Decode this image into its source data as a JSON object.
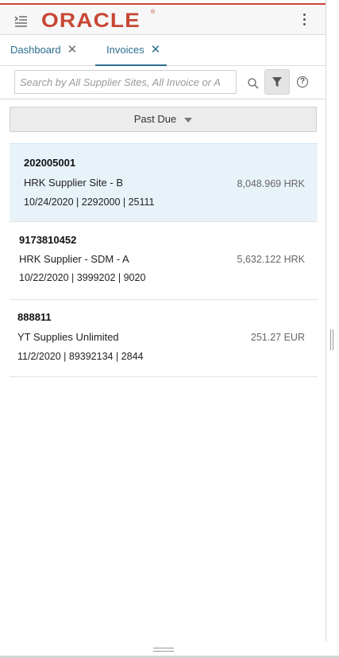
{
  "header": {
    "logo": "ORACLE",
    "logo_mark": "®",
    "menu_icon": "menu-collapse-icon",
    "more_icon": "kebab-menu-icon"
  },
  "tabs": [
    {
      "label": "Dashboard",
      "close": "✕",
      "active": false
    },
    {
      "label": "Invoices",
      "close": "✕",
      "active": true
    }
  ],
  "search": {
    "placeholder": "Search by All Supplier Sites, All Invoice or A",
    "value": "",
    "search_icon": "search-icon",
    "filter_icon": "filter-icon",
    "help_icon": "?"
  },
  "filter_select": {
    "selected": "Past Due"
  },
  "invoices": [
    {
      "number": "202005001",
      "supplier": "HRK Supplier Site - B",
      "details": "10/24/2020 | 2292000 | 25111",
      "amount": "8,048.969 HRK",
      "selected": true
    },
    {
      "number": "9173810452",
      "supplier": "HRK Supplier - SDM - A",
      "details": "10/22/2020 | 3999202 | 9020",
      "amount": "5,632.122 HRK",
      "selected": false
    },
    {
      "number": "888811",
      "supplier": "YT Supplies Unlimited",
      "details": "11/2/2020 | 89392134 | 2844",
      "amount": "251.27 EUR",
      "selected": false
    }
  ],
  "colors": {
    "brand_red": "#c74634",
    "link_blue": "#2c6e8f",
    "selected_row": "#e8f2f9"
  }
}
